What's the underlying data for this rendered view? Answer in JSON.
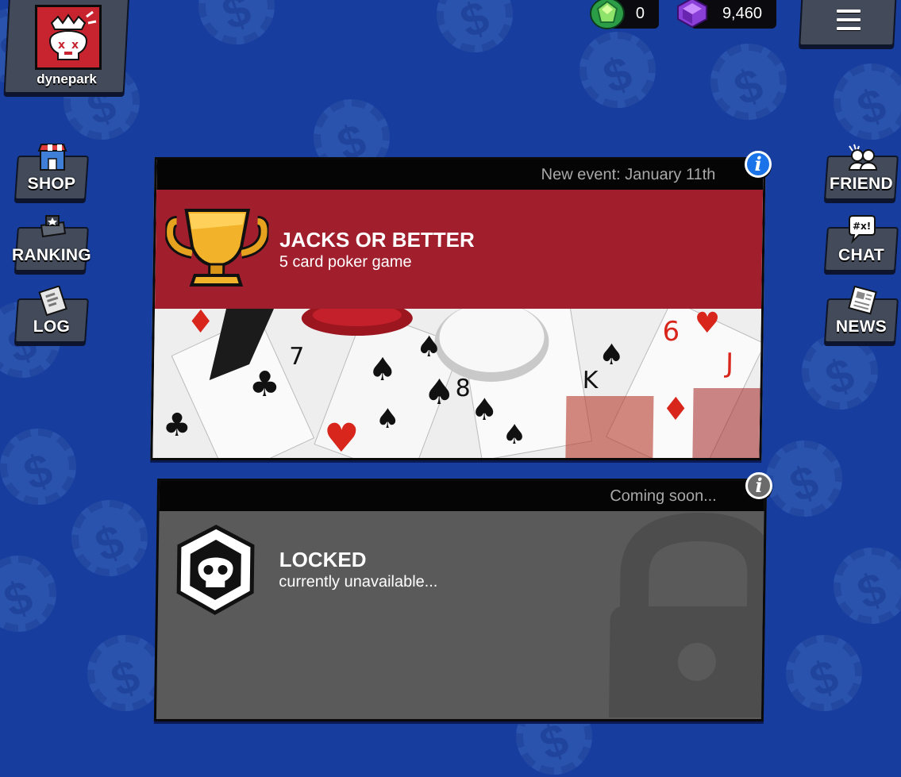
{
  "player": {
    "username": "dynepark",
    "avatar_icon": "skull-crown-icon"
  },
  "currencies": {
    "green_gems": {
      "icon": "green-gem-icon",
      "value": "0"
    },
    "purple_gems": {
      "icon": "purple-gem-icon",
      "value": "9,460"
    }
  },
  "menu": {
    "icon": "hamburger-menu-icon"
  },
  "left_nav": [
    {
      "label": "SHOP",
      "icon": "shop-icon"
    },
    {
      "label": "RANKING",
      "icon": "ranking-icon"
    },
    {
      "label": "LOG",
      "icon": "log-icon"
    }
  ],
  "right_nav": [
    {
      "label": "FRIEND",
      "icon": "friends-icon"
    },
    {
      "label": "CHAT",
      "icon": "chat-bubble-icon"
    },
    {
      "label": "NEWS",
      "icon": "newspaper-icon"
    }
  ],
  "games": [
    {
      "header": "New event: January 11th",
      "title": "JACKS OR BETTER",
      "subtitle": "5 card poker game",
      "icon": "trophy-icon",
      "accent": "#a11e2d"
    },
    {
      "header": "Coming soon...",
      "title": "LOCKED",
      "subtitle": "currently unavailable...",
      "icon": "skull-badge-icon",
      "accent": "#5a5a5a"
    }
  ],
  "colors": {
    "background": "#173e9f",
    "button": "#434b5a",
    "event_banner": "#a11e2d",
    "locked_panel": "#5a5a5a",
    "info_blue": "#1a73e8",
    "info_gray": "#6b6b6b"
  }
}
